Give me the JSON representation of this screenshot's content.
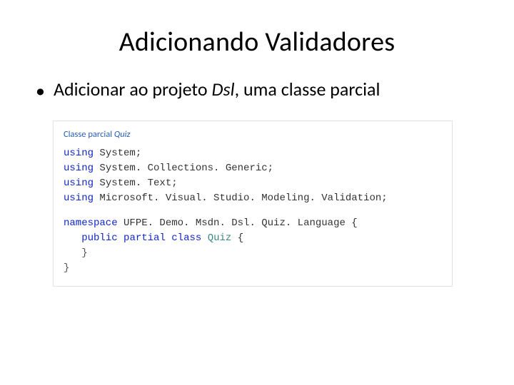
{
  "title": "Adicionando Validadores",
  "bullet": {
    "prefix": "Adicionar ao projeto ",
    "italic": "Dsl",
    "suffix": ", uma classe parcial"
  },
  "code": {
    "caption_prefix": "Classe parcial ",
    "caption_italic": "Quiz",
    "kw_using": "using",
    "kw_namespace": "namespace",
    "kw_public": "public",
    "kw_partial": "partial",
    "kw_class": "class",
    "ns1": " System;",
    "ns2": " System. Collections. Generic;",
    "ns3": " System. Text;",
    "ns4": " Microsoft. Visual. Studio. Modeling. Validation;",
    "ns_decl": " UFPE. Demo. Msdn. Dsl. Quiz. Language {",
    "class_pad": "   ",
    "class_space": " ",
    "class_name": "Quiz",
    "class_open": " {",
    "close1": "   }",
    "close2": "}"
  }
}
